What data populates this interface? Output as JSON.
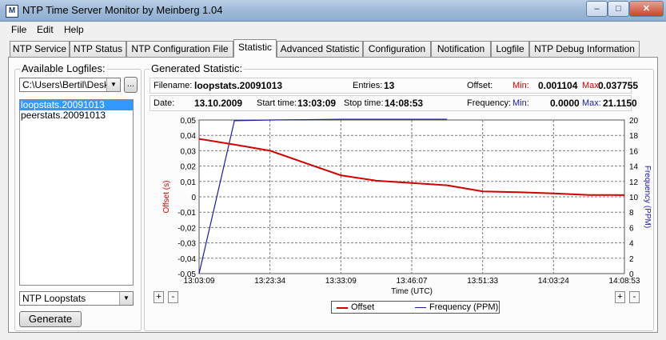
{
  "window": {
    "title": "NTP Time Server Monitor by Meinberg 1.04",
    "icon_text": "M",
    "minimize": "–",
    "maximize": "□",
    "close": "✕"
  },
  "menu": [
    "File",
    "Edit",
    "Help"
  ],
  "tabs": [
    "NTP Service",
    "NTP Status",
    "NTP Configuration File",
    "Statistic",
    "Advanced Statistic",
    "Configuration",
    "Notification",
    "Logfile",
    "NTP Debug Information"
  ],
  "active_tab": "Statistic",
  "logfiles": {
    "legend": "Available Logfiles:",
    "path": "C:\\Users\\Bertil\\Deskto",
    "browse_label": "...",
    "items": [
      "loopstats.20091013",
      "peerstats.20091013"
    ],
    "selected": "loopstats.20091013",
    "type_select": "NTP Loopstats",
    "generate_label": "Generate"
  },
  "statistic": {
    "legend": "Generated Statistic:",
    "filename_label": "Filename:",
    "filename": "loopstats.20091013",
    "entries_label": "Entries:",
    "entries": "13",
    "offset_label": "Offset:",
    "min_label": "Min:",
    "offset_min": "0.001104",
    "max_label": "Max:",
    "offset_max": "0.037755",
    "date_label": "Date:",
    "date": "13.10.2009",
    "start_label": "Start time:",
    "start_time": "13:03:09",
    "stop_label": "Stop time:",
    "stop_time": "14:08:53",
    "frequency_label": "Frequency:",
    "freq_min": "0.0000",
    "freq_max": "21.1150"
  },
  "zoom": {
    "plus": "+",
    "minus": "-"
  },
  "colors": {
    "offset": "#d00000",
    "frequency": "#1a1aa0",
    "grid": "#7a7a7a"
  },
  "chart_data": {
    "type": "line",
    "xlabel": "Time (UTC)",
    "ylabel_left": "Offset (s)",
    "ylabel_right": "Frequency (PPM)",
    "x_ticks": [
      "13:03:09",
      "13:23:34",
      "13:33:09",
      "13:46:07",
      "13:51:33",
      "14:03:24",
      "14:08:53"
    ],
    "y_left_ticks": [
      "0,05",
      "0,04",
      "0,03",
      "0,02",
      "0,01",
      "0",
      "-0,01",
      "-0,02",
      "-0,03",
      "-0,04",
      "-0,05"
    ],
    "y_right_ticks": [
      "20",
      "18",
      "16",
      "14",
      "12",
      "10",
      "8",
      "6",
      "4",
      "2",
      "0"
    ],
    "ylim_left": [
      -0.05,
      0.05
    ],
    "ylim_right": [
      0,
      21
    ],
    "grid": true,
    "legend_position": "bottom-center",
    "series": [
      {
        "name": "Offset",
        "axis": "left",
        "x": [
          0,
          0.083,
          0.167,
          0.25,
          0.333,
          0.417,
          0.5,
          0.583,
          0.667,
          0.75,
          0.833,
          0.917,
          1.0
        ],
        "values": [
          0.0377,
          0.034,
          0.03,
          0.022,
          0.014,
          0.0105,
          0.009,
          0.0075,
          0.0035,
          0.003,
          0.0022,
          0.0012,
          0.0011
        ]
      },
      {
        "name": "Frequency (PPM)",
        "axis": "right",
        "x": [
          0,
          0.083,
          0.167,
          0.25,
          0.333,
          0.417,
          0.5,
          0.583
        ],
        "values": [
          0.0,
          20.9,
          21.0,
          21.05,
          21.1,
          21.1,
          21.1,
          21.1
        ]
      }
    ]
  }
}
